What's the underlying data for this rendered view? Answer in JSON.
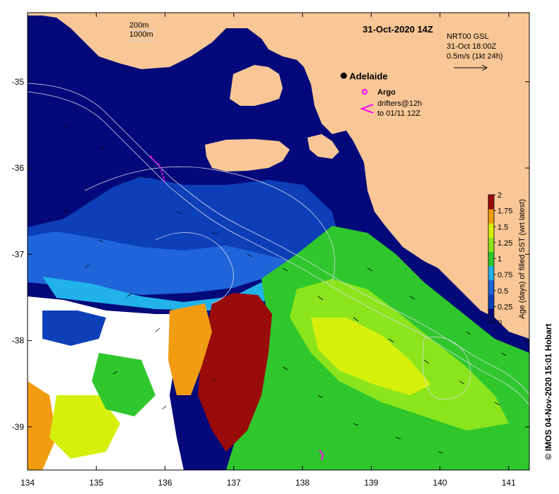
{
  "map": {
    "title": "31-Oct-2020 14Z",
    "lon_range": [
      134,
      141.3
    ],
    "lat_range": [
      -39.5,
      -34.2
    ],
    "lon_ticks": [
      "134",
      "135",
      "136",
      "137",
      "138",
      "139",
      "140",
      "141"
    ],
    "lat_ticks": [
      "-35",
      "-36",
      "-37",
      "-38",
      "-39"
    ],
    "contour_legend": {
      "line1": "200m",
      "line2": "1000m"
    },
    "current_legend": {
      "line1": "NRT00 GSL",
      "line2": "31-Oct 18:00Z",
      "line3": "0.5m/s (1kt 24h)"
    },
    "city": {
      "name": "Adelaide",
      "lon": 138.6,
      "lat": -34.93
    },
    "argo_label": "Argo",
    "drifters": {
      "line1": "drifters@12h",
      "line2": "to 01/11 12Z"
    },
    "colorbar": {
      "label": "Age (days) of filled SST (wrt latest)",
      "ticks": [
        "0",
        "0.25",
        "0.5",
        "0.75",
        "1",
        "1.25",
        "1.5",
        "1.75",
        "2"
      ],
      "min": 0,
      "max": 2
    },
    "credit": "© IMOS 04-Nov-2020 15:01 Hobart",
    "colors": {
      "land": "#f9c796",
      "deep_blue": "#03097a",
      "blue": "#0c3fb8",
      "mid_blue": "#1f64d9",
      "light_blue": "#21b2e9",
      "green": "#2fc72d",
      "light_green": "#8ce51c",
      "yellow_green": "#d6f00c",
      "orange": "#f29c12",
      "dark_red": "#9a0b0b",
      "magenta": "#ff00ff"
    }
  }
}
